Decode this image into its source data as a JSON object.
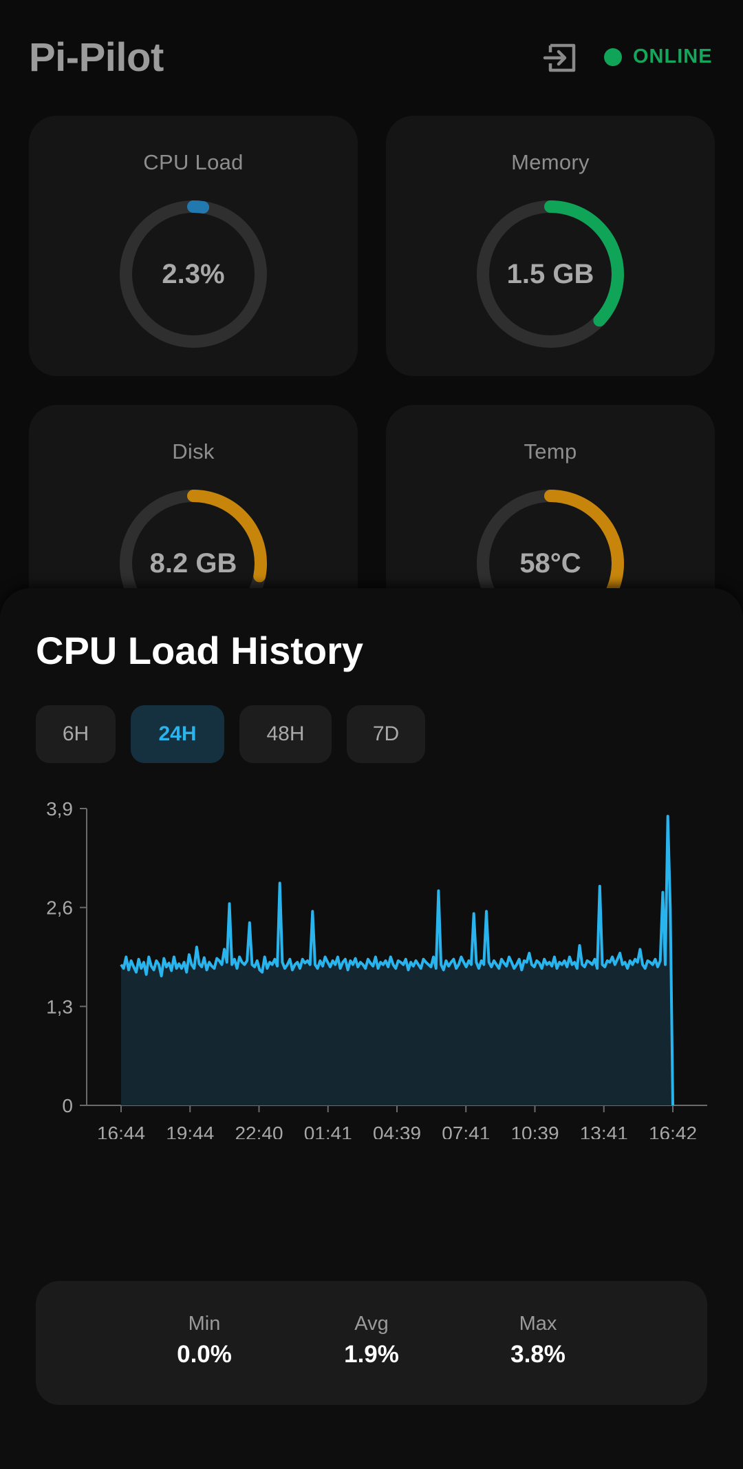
{
  "header": {
    "title": "Pi-Pilot",
    "status_label": "ONLINE",
    "status_color": "#0fa457",
    "logout_icon": "logout-icon"
  },
  "metrics": [
    {
      "title": "CPU Load",
      "value": "2.3%",
      "percent": 2.3,
      "color": "#2279b0"
    },
    {
      "title": "Memory",
      "value": "1.5 GB",
      "percent": 37,
      "color": "#0fa457"
    },
    {
      "title": "Disk",
      "value": "8.2 GB",
      "percent": 28,
      "color": "#c7860b"
    },
    {
      "title": "Temp",
      "value": "58°C",
      "percent": 58,
      "color": "#c7860b"
    }
  ],
  "history": {
    "title": "CPU Load History",
    "ranges": [
      {
        "label": "6H",
        "active": false
      },
      {
        "label": "24H",
        "active": true
      },
      {
        "label": "48H",
        "active": false
      },
      {
        "label": "7D",
        "active": false
      }
    ],
    "stats": {
      "min_label": "Min",
      "min_value": "0.0%",
      "avg_label": "Avg",
      "avg_value": "1.9%",
      "max_label": "Max",
      "max_value": "3.8%"
    }
  },
  "chart_data": {
    "type": "area",
    "x_tick_labels": [
      "16:44",
      "19:44",
      "22:40",
      "01:41",
      "04:39",
      "07:41",
      "10:39",
      "13:41",
      "16:42"
    ],
    "y_tick_labels": [
      "0",
      "1,3",
      "2,6",
      "3,9"
    ],
    "ylim": [
      0,
      3.9
    ],
    "grid": false,
    "line_color": "#2ab4ee",
    "fill_color": "#142630",
    "values": [
      1.85,
      1.8,
      1.95,
      1.78,
      1.9,
      1.82,
      1.75,
      1.92,
      1.8,
      1.88,
      1.72,
      1.95,
      1.83,
      1.78,
      1.9,
      1.85,
      1.7,
      1.93,
      1.82,
      1.87,
      1.77,
      1.95,
      1.8,
      1.86,
      1.8,
      1.88,
      1.75,
      1.98,
      1.85,
      1.8,
      2.08,
      1.86,
      1.82,
      1.94,
      1.78,
      1.88,
      1.83,
      1.8,
      1.93,
      1.9,
      1.85,
      2.05,
      1.88,
      2.65,
      1.85,
      1.92,
      1.8,
      1.95,
      1.88,
      1.85,
      1.9,
      2.4,
      1.85,
      1.82,
      1.9,
      1.78,
      1.75,
      1.95,
      1.8,
      1.88,
      1.85,
      1.92,
      1.83,
      2.92,
      1.88,
      1.8,
      1.85,
      1.92,
      1.78,
      1.85,
      1.88,
      1.8,
      1.92,
      1.87,
      1.9,
      1.85,
      2.55,
      1.85,
      1.8,
      1.9,
      1.83,
      1.95,
      1.88,
      1.82,
      1.9,
      1.85,
      1.95,
      1.8,
      1.88,
      1.92,
      1.78,
      1.9,
      1.85,
      1.93,
      1.82,
      1.88,
      1.85,
      1.8,
      1.92,
      1.87,
      1.83,
      1.95,
      1.8,
      1.88,
      1.85,
      1.9,
      1.82,
      1.95,
      1.85,
      1.8,
      1.9,
      1.88,
      1.85,
      1.92,
      1.78,
      1.88,
      1.83,
      1.9,
      1.85,
      1.8,
      1.92,
      1.88,
      1.85,
      1.82,
      1.95,
      1.8,
      2.82,
      1.85,
      1.78,
      1.9,
      1.83,
      1.88,
      1.92,
      1.8,
      1.85,
      1.95,
      1.88,
      1.82,
      1.9,
      1.85,
      2.52,
      1.88,
      1.8,
      1.9,
      1.85,
      2.55,
      1.88,
      1.82,
      1.9,
      1.85,
      1.8,
      1.92,
      1.87,
      1.83,
      1.95,
      1.88,
      1.8,
      1.85,
      1.92,
      1.78,
      1.9,
      1.88,
      2.0,
      1.85,
      1.82,
      1.9,
      1.87,
      1.8,
      1.92,
      1.85,
      1.88,
      1.83,
      1.95,
      1.8,
      1.88,
      1.85,
      1.9,
      1.82,
      1.95,
      1.85,
      1.88,
      1.8,
      2.1,
      1.85,
      1.82,
      1.9,
      1.88,
      1.85,
      1.92,
      1.8,
      2.88,
      1.85,
      1.82,
      1.9,
      1.88,
      1.95,
      1.85,
      1.92,
      2.0,
      1.85,
      1.88,
      1.8,
      1.9,
      1.85,
      1.92,
      1.88,
      2.05,
      1.85,
      1.8,
      1.9,
      1.88,
      1.85,
      1.92,
      1.82,
      1.9,
      2.8,
      1.85,
      3.8,
      2.6,
      0.0
    ]
  }
}
